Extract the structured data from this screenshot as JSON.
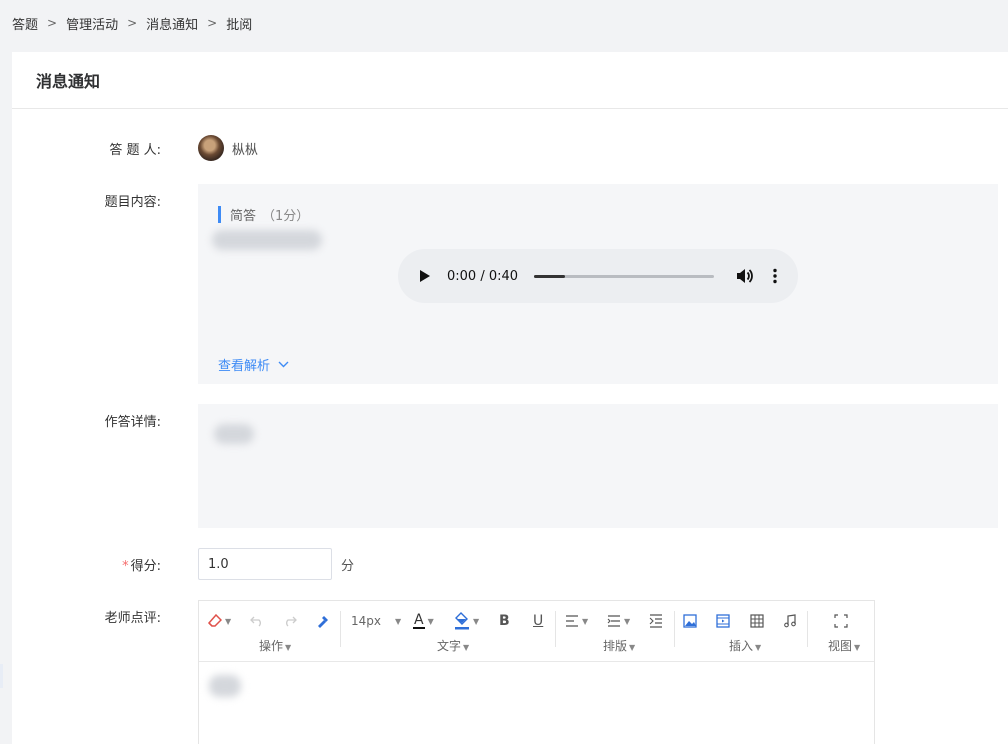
{
  "breadcrumb": {
    "items": [
      "答题",
      "管理活动",
      "消息通知",
      "批阅"
    ],
    "separator": ">"
  },
  "page": {
    "title": "消息通知"
  },
  "labels": {
    "answerer": "答 题 人:",
    "question": "题目内容:",
    "answer_detail": "作答详情:",
    "score_required_mark": "*",
    "score": "得分:",
    "comment": "老师点评:"
  },
  "answerer": {
    "name": "枞枞"
  },
  "question": {
    "type": "简答",
    "points": "（1分）",
    "audio": {
      "time": "0:00 / 0:40",
      "progress": 0.17
    },
    "analysis_link": "查看解析"
  },
  "score": {
    "value": "1.0",
    "unit": "分"
  },
  "editor": {
    "font_size": "14px",
    "groups": {
      "operate": "操作",
      "text": "文字",
      "layout": "排版",
      "insert": "插入",
      "view": "视图"
    },
    "tools": {
      "bold": "B",
      "underline": "U",
      "font_color": "A"
    }
  },
  "colors": {
    "accent": "#3e8bf5",
    "required": "#f56c6c",
    "box_bg": "#f5f6f8",
    "page_bg": "#f2f3f5"
  }
}
